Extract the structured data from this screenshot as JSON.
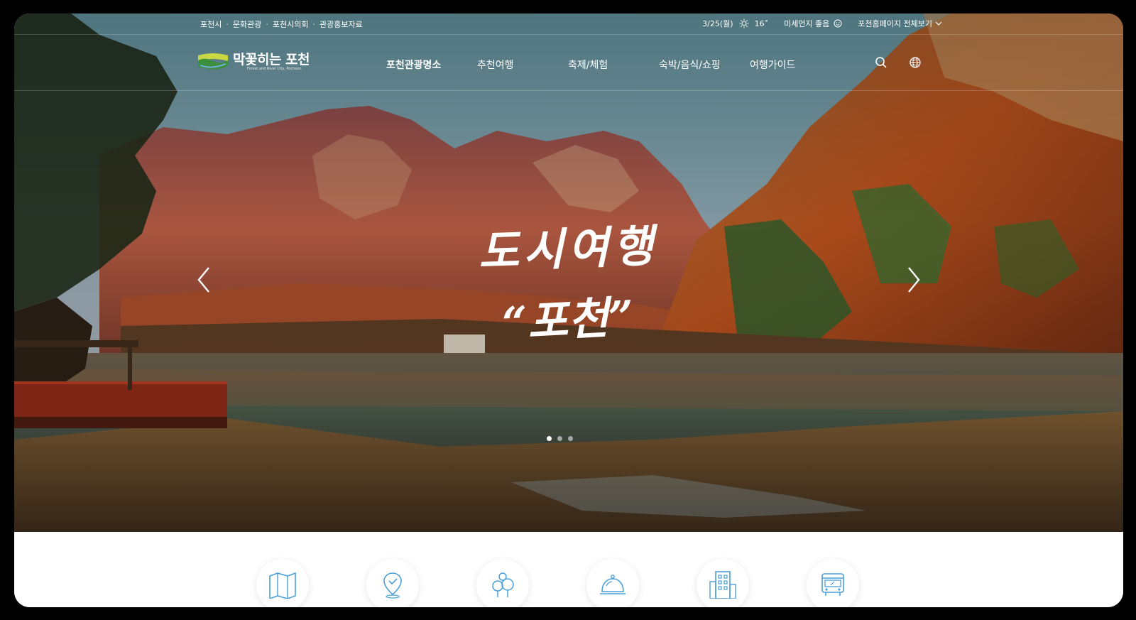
{
  "top_links": [
    "포천시",
    "문화관광",
    "포천시의회",
    "관광홍보자료"
  ],
  "weather": {
    "date": "3/25(월)",
    "temp": "16˚",
    "dust": "미세먼지 좋음",
    "icon": "sun-icon"
  },
  "all_sites": "포천홈페이지 전체보기",
  "logo": {
    "title": "막꽃히는 포천",
    "subtitle": "Forest and River City, Pocheon"
  },
  "menu": [
    "포천관광명소",
    "추천여행",
    "축제/체험",
    "숙박/음식/쇼핑",
    "여행가이드"
  ],
  "active_menu_index": 0,
  "hero": {
    "line1": "도시여행",
    "line2": "“포천”",
    "slide_count": 3,
    "active_slide": 1
  },
  "quick_icons": [
    "map-icon",
    "location-icon",
    "trees-icon",
    "food-dome-icon",
    "building-icon",
    "bus-icon"
  ],
  "colors": {
    "accent": "#4a9fd8",
    "logo_green": "#3c8f3b",
    "logo_yellow": "#c7d843"
  }
}
